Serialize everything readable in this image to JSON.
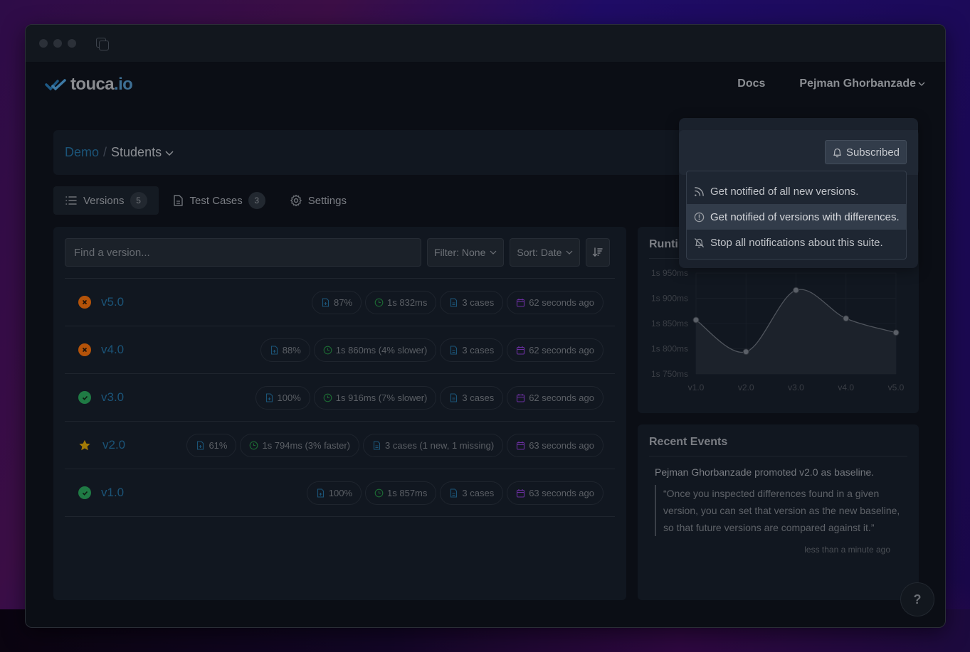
{
  "window": {
    "tab_icon": "copy-tabs-icon"
  },
  "nav": {
    "logo_main": "touca",
    "logo_tld": ".io",
    "docs_label": "Docs",
    "user_name": "Pejman Ghorbanzade"
  },
  "breadcrumb": {
    "team": "Demo",
    "separator": "/",
    "suite": "Students"
  },
  "subscription": {
    "button_label": "Subscribed",
    "menu": [
      {
        "icon": "rss-icon",
        "label": "Get notified of all new versions.",
        "highlighted": false
      },
      {
        "icon": "alert-circle-icon",
        "label": "Get notified of versions with differences.",
        "highlighted": true
      },
      {
        "icon": "bell-off-icon",
        "label": "Stop all notifications about this suite.",
        "highlighted": false
      }
    ]
  },
  "tabs": [
    {
      "label": "Versions",
      "count": "5",
      "icon": "list-icon",
      "active": true
    },
    {
      "label": "Test Cases",
      "count": "3",
      "icon": "document-icon",
      "active": false
    },
    {
      "label": "Settings",
      "icon": "gear-icon",
      "active": false
    }
  ],
  "toolbar": {
    "search_placeholder": "Find a version...",
    "filter_label": "Filter: None",
    "sort_label": "Sort: Date"
  },
  "colors": {
    "fail": "#b45309",
    "pass": "#1f7a44",
    "baseline": "#a17a06",
    "accent": "#1b5478",
    "clock": "#1c6b33",
    "calendar": "#6b2fa0",
    "doc": "#1b5478"
  },
  "versions": [
    {
      "name": "v5.0",
      "status": "fail",
      "match": "87%",
      "time": "1s 832ms",
      "cases": "3 cases",
      "submitted": "62 seconds ago"
    },
    {
      "name": "v4.0",
      "status": "fail",
      "match": "88%",
      "time": "1s 860ms (4% slower)",
      "cases": "3 cases",
      "submitted": "62 seconds ago"
    },
    {
      "name": "v3.0",
      "status": "pass",
      "match": "100%",
      "time": "1s 916ms (7% slower)",
      "cases": "3 cases",
      "submitted": "62 seconds ago"
    },
    {
      "name": "v2.0",
      "status": "baseline",
      "match": "61%",
      "time": "1s 794ms (3% faster)",
      "cases": "3 cases (1 new, 1 missing)",
      "submitted": "63 seconds ago"
    },
    {
      "name": "v1.0",
      "status": "pass",
      "match": "100%",
      "time": "1s 857ms",
      "cases": "3 cases",
      "submitted": "63 seconds ago"
    }
  ],
  "runtime": {
    "title": "Runtime"
  },
  "chart_data": {
    "type": "area",
    "title": "Runtime",
    "categories": [
      "v1.0",
      "v2.0",
      "v3.0",
      "v4.0",
      "v5.0"
    ],
    "values": [
      1857,
      1794,
      1916,
      1860,
      1832
    ],
    "unit": "ms",
    "yticks": [
      1750,
      1800,
      1850,
      1900,
      1950
    ],
    "ytick_labels": [
      "1s 750ms",
      "1s 800ms",
      "1s 850ms",
      "1s 900ms",
      "1s 950ms"
    ],
    "ylim": [
      1750,
      1950
    ],
    "grid": true,
    "xlabel": "",
    "ylabel": ""
  },
  "events": {
    "title": "Recent Events",
    "actor": "Pejman Ghorbanzade",
    "action": " promoted v2.0 as baseline.",
    "quote": "“Once you inspected differences found in a given version, you can set that version as the new baseline, so that future versions are compared against it.”",
    "time": "less than a minute ago"
  },
  "help": {
    "label": "?"
  }
}
